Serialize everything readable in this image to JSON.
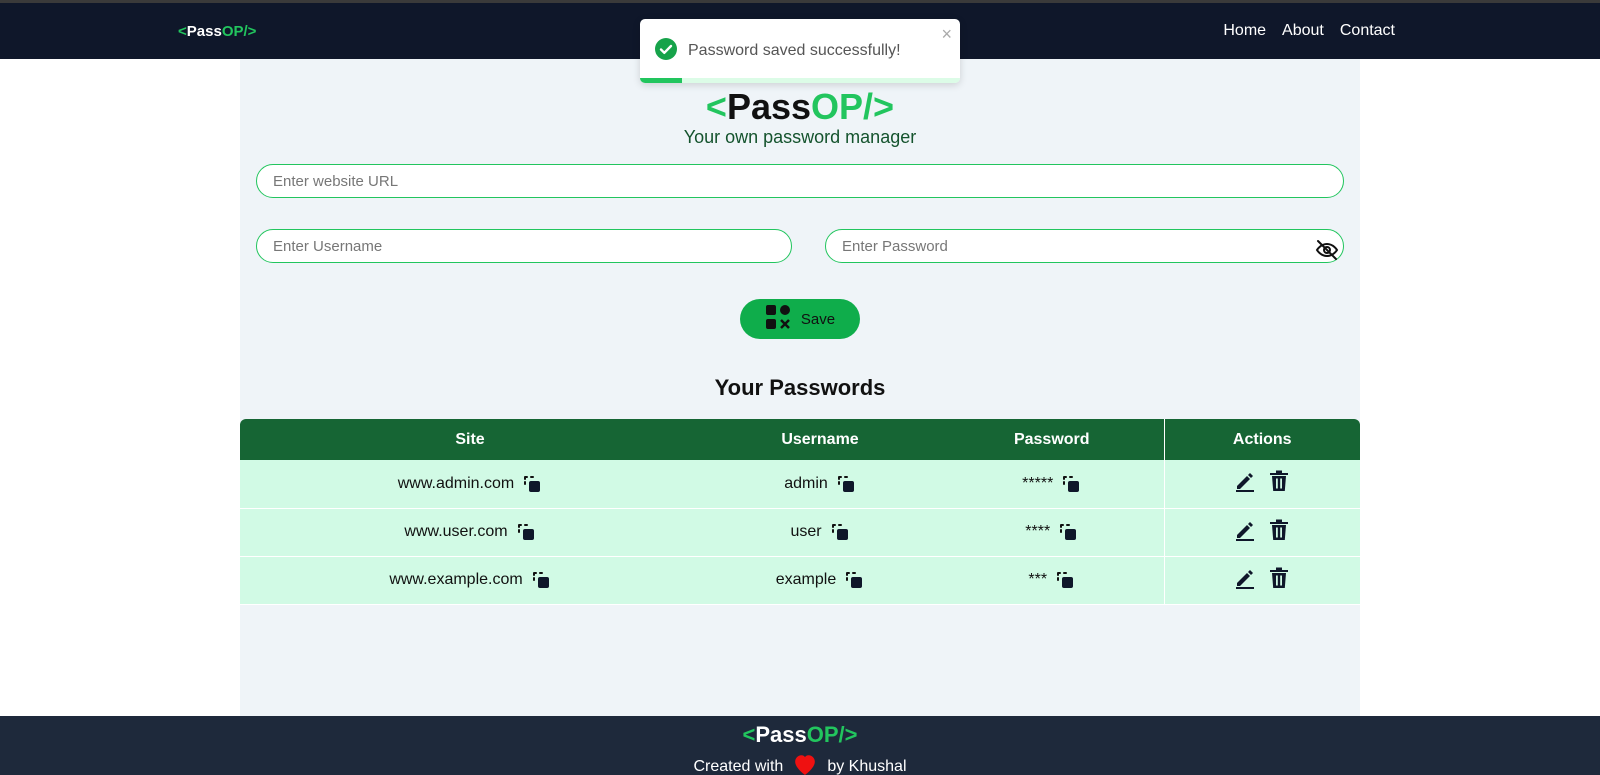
{
  "nav": {
    "logo": {
      "lt": "<",
      "pass": "Pass",
      "op": "OP/",
      "gt": ">"
    },
    "links": [
      "Home",
      "About",
      "Contact"
    ]
  },
  "toast": {
    "message": "Password saved successfully!",
    "close": "×",
    "progress": 0.13
  },
  "header": {
    "logo": {
      "lt": "<",
      "pass": "Pass",
      "op": "OP/",
      "gt": ">"
    },
    "subtitle": "Your own password manager"
  },
  "form": {
    "url_placeholder": "Enter website URL",
    "username_placeholder": "Enter Username",
    "password_placeholder": "Enter Password",
    "url_value": "",
    "username_value": "",
    "password_value": "",
    "save_label": "Save"
  },
  "passwords": {
    "heading": "Your Passwords",
    "columns": [
      "Site",
      "Username",
      "Password",
      "Actions"
    ],
    "rows": [
      {
        "site": "www.admin.com",
        "username": "admin",
        "password": "*****"
      },
      {
        "site": "www.user.com",
        "username": "user",
        "password": "****"
      },
      {
        "site": "www.example.com",
        "username": "example",
        "password": "***"
      }
    ]
  },
  "footer": {
    "logo": {
      "lt": "<",
      "pass": "Pass",
      "op": "OP/",
      "gt": ">"
    },
    "credit_prefix": "Created with",
    "credit_suffix": "by Khushal"
  },
  "colors": {
    "nav_bg": "#0f172a",
    "accent_green": "#22c55e",
    "table_header": "#166534",
    "table_row": "#d1fae5",
    "footer_bg": "#1e293b",
    "heart": "#ef4444"
  },
  "icons": {
    "copy": "copy-icon",
    "edit": "edit-icon",
    "delete": "trash-icon",
    "eye": "eye-off-icon",
    "save": "save-icon",
    "success": "check-circle-icon",
    "heart": "heart-icon"
  }
}
